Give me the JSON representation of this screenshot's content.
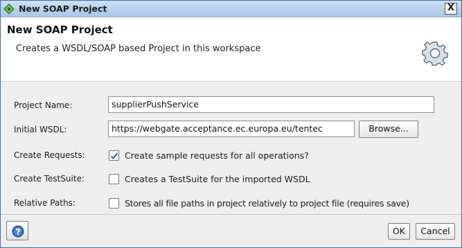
{
  "window": {
    "title": "New SOAP Project",
    "close_glyph": "X"
  },
  "header": {
    "title": "New SOAP Project",
    "description": "Creates a WSDL/SOAP based Project in this workspace",
    "icon": "gear-icon"
  },
  "form": {
    "project_name_label": "Project Name:",
    "project_name_value": "supplierPushService",
    "initial_wsdl_label": "Initial WSDL:",
    "initial_wsdl_value": "https://webgate.acceptance.ec.europa.eu/tentec",
    "browse_label": "Browse...",
    "create_requests_label": "Create Requests:",
    "create_requests_text": "Create sample requests for all operations?",
    "create_requests_checked": true,
    "create_testsuite_label": "Create TestSuite:",
    "create_testsuite_text": "Creates a TestSuite for the imported WSDL",
    "create_testsuite_checked": false,
    "relative_paths_label": "Relative Paths:",
    "relative_paths_text": "Stores all file paths in project relatively to project file (requires save)",
    "relative_paths_checked": false
  },
  "footer": {
    "help_icon": "help-icon",
    "ok_label": "OK",
    "cancel_label": "Cancel"
  },
  "colors": {
    "titlebar": "#b9d1ee",
    "accent": "#2b68b8",
    "check_mark": "#2a5db0",
    "panel": "#eeeeee"
  }
}
